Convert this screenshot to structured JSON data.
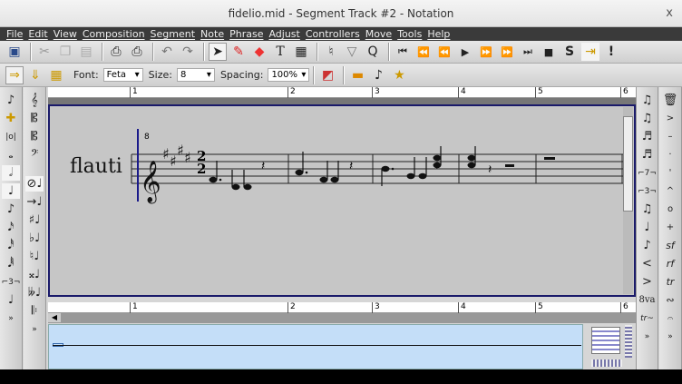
{
  "window": {
    "title": "fidelio.mid - Segment Track #2 - Notation",
    "close": "x"
  },
  "menu": [
    "File",
    "Edit",
    "View",
    "Composition",
    "Segment",
    "Note",
    "Phrase",
    "Adjust",
    "Controllers",
    "Move",
    "Tools",
    "Help"
  ],
  "toolbar2": {
    "font_label": "Font:",
    "font_value": "Feta",
    "size_label": "Size:",
    "size_value": "8",
    "spacing_label": "Spacing:",
    "spacing_value": "100%"
  },
  "ruler": [
    "1",
    "2",
    "3",
    "4",
    "5",
    "6"
  ],
  "staff": {
    "instrument": "flauti",
    "clef_octave": "8",
    "time_sig_top": "2",
    "time_sig_bottom": "2"
  },
  "colors": {
    "menubar": "#3a3a3a",
    "score_bg": "#c6c6c6",
    "panner": "#c4def8",
    "border": "#1a1a6a"
  }
}
